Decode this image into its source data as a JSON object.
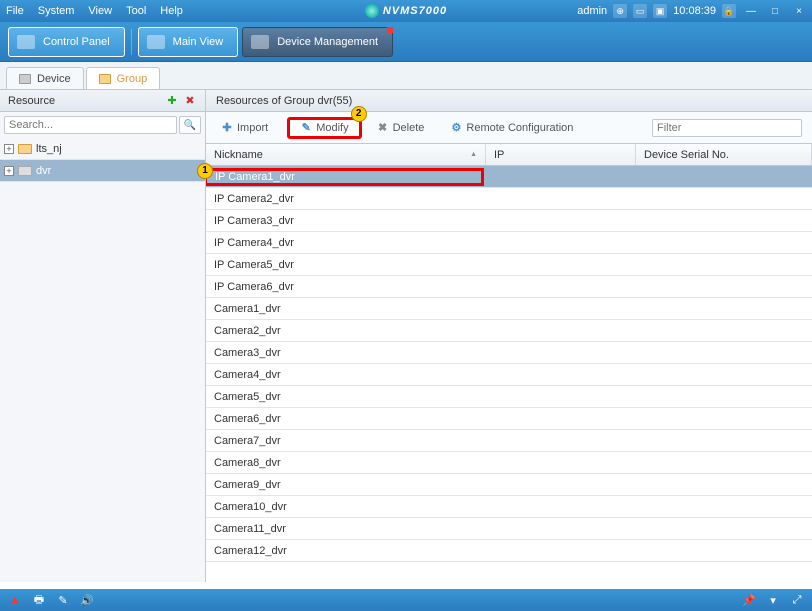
{
  "menu": {
    "items": [
      "File",
      "System",
      "View",
      "Tool",
      "Help"
    ],
    "brand": "NVMS7000",
    "user": "admin",
    "time": "10:08:39"
  },
  "toolbar": {
    "control_panel": "Control Panel",
    "main_view": "Main View",
    "device_mgmt": "Device Management"
  },
  "subtabs": {
    "device": "Device",
    "group": "Group"
  },
  "left": {
    "header": "Resource",
    "search_placeholder": "Search...",
    "tree": [
      {
        "label": "lts_nj",
        "selected": false
      },
      {
        "label": "dvr",
        "selected": true
      }
    ]
  },
  "right": {
    "header": "Resources of Group dvr(55)",
    "actions": {
      "import": "Import",
      "modify": "Modify",
      "delete": "Delete",
      "remote": "Remote Configuration"
    },
    "filter_placeholder": "Filter",
    "columns": {
      "nickname": "Nickname",
      "ip": "IP",
      "serial": "Device Serial No."
    },
    "rows": [
      "IP Camera1_dvr",
      "IP Camera2_dvr",
      "IP Camera3_dvr",
      "IP Camera4_dvr",
      "IP Camera5_dvr",
      "IP Camera6_dvr",
      "Camera1_dvr",
      "Camera2_dvr",
      "Camera3_dvr",
      "Camera4_dvr",
      "Camera5_dvr",
      "Camera6_dvr",
      "Camera7_dvr",
      "Camera8_dvr",
      "Camera9_dvr",
      "Camera10_dvr",
      "Camera11_dvr",
      "Camera12_dvr"
    ],
    "selected_row_index": 0
  },
  "annotations": {
    "one": "1",
    "two": "2"
  }
}
